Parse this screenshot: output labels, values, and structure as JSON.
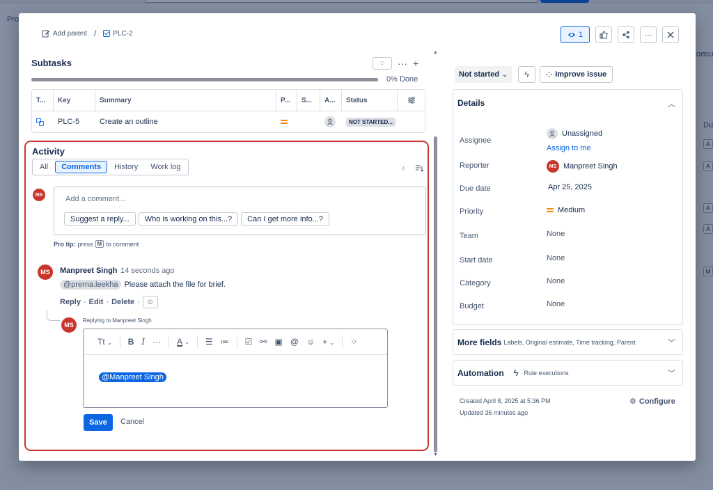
{
  "background": {
    "left_texts": [
      "Pro"
    ],
    "right_text": "ortcut",
    "right_col_head": "Du",
    "right_col_cells": [
      "A",
      "A",
      "A",
      "A",
      "M"
    ]
  },
  "breadcrumb": {
    "add_parent": "Add parent",
    "separator": "/",
    "issue_key": "PLC-2"
  },
  "header_actions": {
    "watch_count": "1"
  },
  "subtasks": {
    "title": "Subtasks",
    "progress_pct": 0,
    "progress_label": "0% Done",
    "columns": [
      "T...",
      "Key",
      "Summary",
      "P...",
      "S...",
      "A...",
      "Status"
    ],
    "rows": [
      {
        "key": "PLC-5",
        "summary": "Create an outline",
        "priority": "medium",
        "status": "NOT STARTED..."
      }
    ]
  },
  "activity": {
    "title": "Activity",
    "tabs": [
      "All",
      "Comments",
      "History",
      "Work log"
    ],
    "active_tab": "Comments",
    "current_user_initials": "MS",
    "comment_placeholder": "Add a comment...",
    "suggestions": [
      "Suggest a reply...",
      "Who is working on this...?",
      "Can I get more info...?"
    ],
    "protip": {
      "prefix": "Pro tip:",
      "press": "press",
      "key": "M",
      "suffix": "to comment"
    },
    "comment": {
      "initials": "MS",
      "author": "Manpreet Singh",
      "time": "14 seconds ago",
      "mention": "@prerna.leekha",
      "text": "Please attach the file for brief.",
      "actions": [
        "Reply",
        "Edit",
        "Delete"
      ],
      "separator": "·"
    },
    "reply": {
      "initials": "MS",
      "replying_to": "Replying to Manpreet Singh",
      "toolbar_text_style": "Tt",
      "content_mention": "@Manpreet Singh",
      "save_label": "Save",
      "cancel_label": "Cancel"
    }
  },
  "right_panel": {
    "status": "Not started",
    "improve_label": "Improve issue",
    "details_title": "Details",
    "fields": [
      {
        "label": "Assignee",
        "value": "Unassigned",
        "link": "Assign to me"
      },
      {
        "label": "Reporter",
        "value": "Manpreet Singh",
        "initials": "MS"
      },
      {
        "label": "Due date",
        "value": "Apr 25, 2025"
      },
      {
        "label": "Priority",
        "value": "Medium"
      },
      {
        "label": "Team",
        "value": "None"
      },
      {
        "label": "Start date",
        "value": "None"
      },
      {
        "label": "Category",
        "value": "None"
      },
      {
        "label": "Budget",
        "value": "None"
      }
    ],
    "more_fields": {
      "title": "More fields",
      "subtitle": "Labels, Original estimate, Time tracking, Parent"
    },
    "automation": {
      "title": "Automation",
      "subtitle": "Rule executions"
    },
    "created": "Created April 8, 2025 at 5:36 PM",
    "updated": "Updated 36 minutes ago",
    "configure_label": "Configure"
  },
  "colors": {
    "accent": "#0c66e4",
    "highlight_border": "#c9372c",
    "avatar": "#c9372c",
    "priority_medium": "#f18d13"
  }
}
